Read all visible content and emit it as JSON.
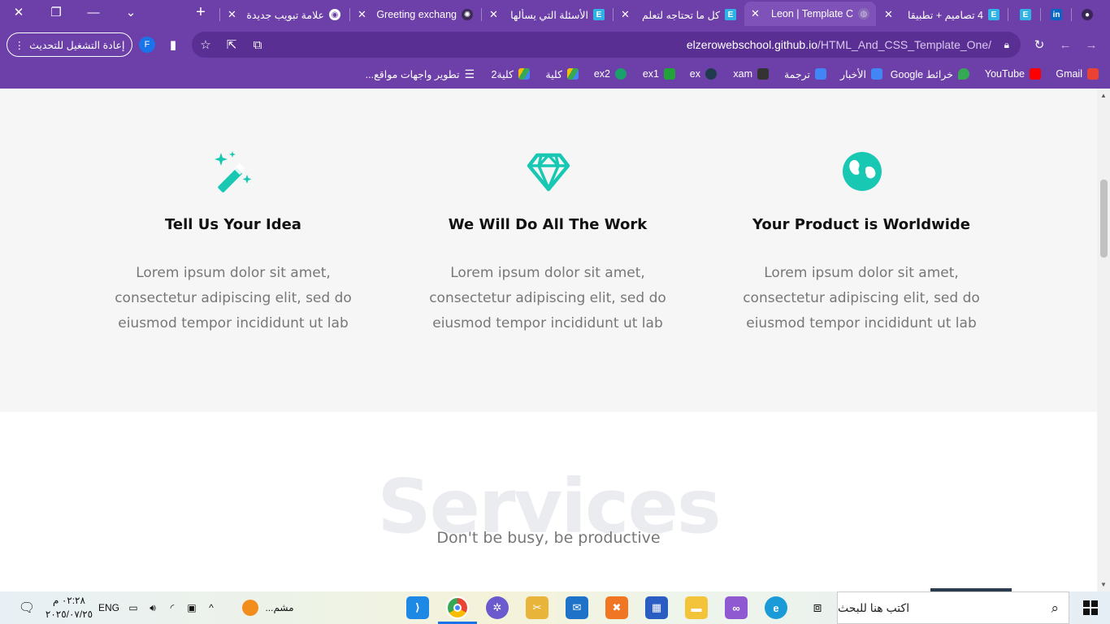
{
  "browser": {
    "tabs": [
      {
        "title": "GitHub",
        "icon": "github-icon",
        "active": false
      },
      {
        "title": "LinkedIn",
        "icon": "linkedin-icon",
        "active": false
      },
      {
        "title": "Elzero",
        "icon": "elzero-icon",
        "active": false
      },
      {
        "title": "4 تصاميم + تطبيقا",
        "icon": "elzero-icon",
        "active": false
      },
      {
        "title": "Leon | Template C",
        "icon": "globe-icon",
        "active": true
      },
      {
        "title": "كل ما تحتاجه لتعلم",
        "icon": "elzero-icon",
        "active": false
      },
      {
        "title": "الأسئلة التي يسألها",
        "icon": "elzero-icon",
        "active": false
      },
      {
        "title": "Greeting exchang",
        "icon": "openai-icon",
        "active": false
      },
      {
        "title": "علامة تبويب جديدة",
        "icon": "chrome-icon",
        "active": false
      }
    ],
    "new_tab_label": "+",
    "relaunch_label": "إعادة التشغيل للتحديث",
    "profile_initial": "F",
    "url_host": "elzerowebschool.github.io",
    "url_path": "/HTML_And_CSS_Template_One/",
    "bookmarks": [
      {
        "label": "Gmail",
        "icon": "gmail-icon",
        "color": "#ea4335"
      },
      {
        "label": "YouTube",
        "icon": "youtube-icon",
        "color": "#ff0000"
      },
      {
        "label": "خرائط Google",
        "icon": "maps-icon",
        "color": "#34a853"
      },
      {
        "label": "الأخبار",
        "icon": "news-icon",
        "color": "#4285f4"
      },
      {
        "label": "ترجمة",
        "icon": "translate-icon",
        "color": "#4285f4"
      },
      {
        "label": "xam",
        "icon": "xam-icon",
        "color": "#333333"
      },
      {
        "label": "ex",
        "icon": "ex-icon",
        "color": "#1f3b4d"
      },
      {
        "label": "ex1",
        "icon": "check-icon",
        "color": "#22a33a"
      },
      {
        "label": "ex2",
        "icon": "ex2-icon",
        "color": "#1aa06a"
      },
      {
        "label": "كلية",
        "icon": "drive-icon",
        "color": "#fbbc04"
      },
      {
        "label": "كلية2",
        "icon": "drive-icon",
        "color": "#fbbc04"
      },
      {
        "label": "تطوير واجهات مواقع...",
        "icon": "list-icon",
        "color": "#ffffff"
      }
    ]
  },
  "page": {
    "accent_color": "#19c8b3",
    "features": [
      {
        "title": "Tell Us Your Idea",
        "icon": "magic-wand-icon",
        "text": "Lorem ipsum dolor sit amet, consectetur adipiscing elit, sed do eiusmod tempor incididunt ut lab"
      },
      {
        "title": "We Will Do All The Work",
        "icon": "diamond-icon",
        "text": "Lorem ipsum dolor sit amet, consectetur adipiscing elit, sed do eiusmod tempor incididunt ut lab"
      },
      {
        "title": "Your Product is Worldwide",
        "icon": "globe-icon",
        "text": "Lorem ipsum dolor sit amet, consectetur adipiscing elit, sed do eiusmod tempor incididunt ut lab"
      }
    ],
    "services_bg_title": "Services",
    "services_subtitle": "Don't be busy, be productive"
  },
  "taskbar": {
    "search_placeholder": "اكتب هنا للبحث",
    "time": "٠٢:٢٨ م",
    "date": "٢٠٢٥/٠٧/٢٥",
    "language": "ENG",
    "media_label": "مشم..."
  }
}
